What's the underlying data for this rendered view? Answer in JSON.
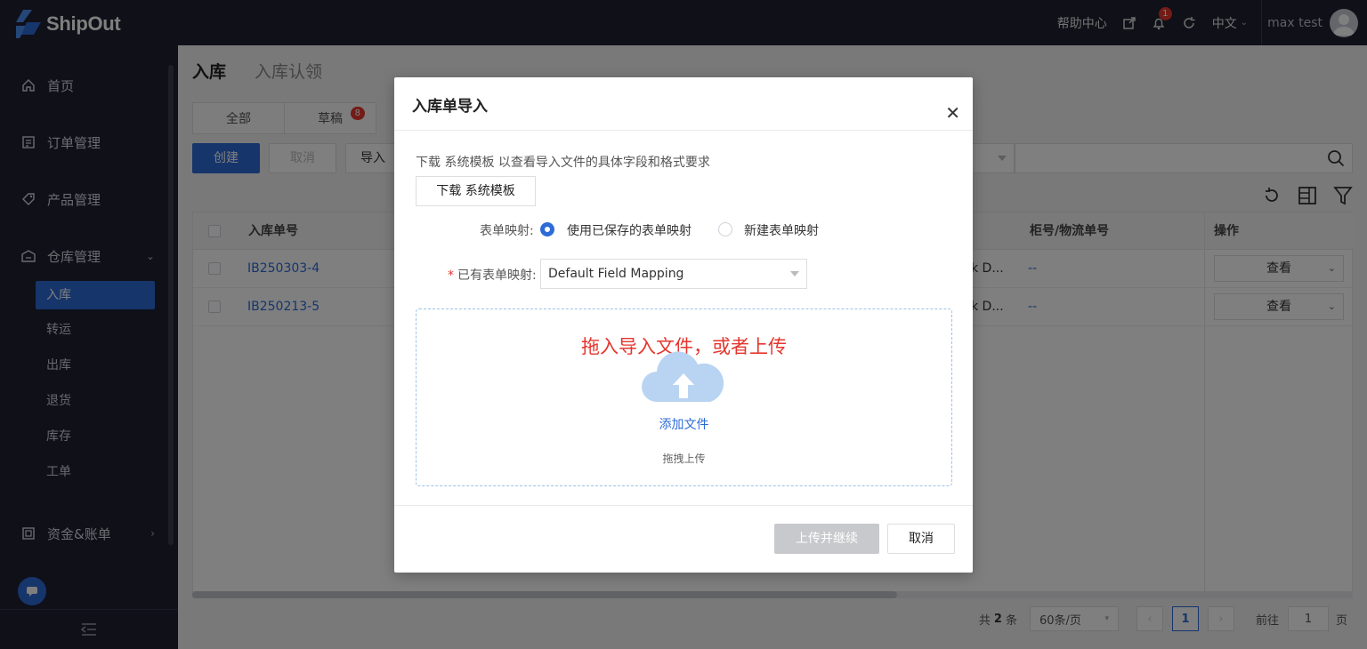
{
  "app": {
    "name": "ShipOut"
  },
  "topbar": {
    "help": "帮助中心",
    "notif_count": "1",
    "language": "中文",
    "user": "max test"
  },
  "sidebar": {
    "items": [
      {
        "label": "首页",
        "icon": "home-icon"
      },
      {
        "label": "订单管理",
        "icon": "order-icon"
      },
      {
        "label": "产品管理",
        "icon": "tag-icon"
      },
      {
        "label": "仓库管理",
        "icon": "warehouse-icon"
      },
      {
        "label": "资金&账单",
        "icon": "bill-icon"
      }
    ],
    "sub_items": [
      "入库",
      "转运",
      "出库",
      "退货",
      "库存",
      "工单"
    ]
  },
  "page": {
    "tab_active": "入库",
    "tab_other": "入库认领",
    "status_tabs": [
      {
        "label": "全部"
      },
      {
        "label": "草稿",
        "count": "8"
      }
    ],
    "toolbar": {
      "create": "创建",
      "cancel": "取消",
      "import": "导入"
    }
  },
  "table": {
    "headers": {
      "order_no": "入库单号",
      "container": "柜号/物流单号",
      "action": "操作"
    },
    "rows": [
      {
        "order_no": "IB250303-4",
        "col_partial": "k D...",
        "container": "--",
        "action": "查看"
      },
      {
        "order_no": "IB250213-5",
        "col_partial": "k D...",
        "container": "--",
        "action": "查看"
      }
    ]
  },
  "pager": {
    "total_prefix": "共",
    "total": "2",
    "total_suffix": "条",
    "page_size": "60条/页",
    "current": "1",
    "goto_label": "前往",
    "goto_value": "1",
    "page_unit": "页"
  },
  "modal": {
    "title": "入库单导入",
    "hint": "下载 系统模板 以查看导入文件的具体字段和格式要求",
    "download_btn": "下载 系统模板",
    "mapping_label": "表单映射:",
    "radio_saved": "使用已保存的表单映射",
    "radio_new": "新建表单映射",
    "existing_label": "已有表单映射:",
    "existing_value": "Default Field Mapping",
    "drop_main": "拖入导入文件，或者上传",
    "add_file": "添加文件",
    "drag_hint": "拖拽上传",
    "upload_btn": "上传并继续",
    "cancel_btn": "取消"
  },
  "colors": {
    "primary": "#2d6bd6",
    "sidebar_bg": "#1f2130",
    "danger": "#e5362e"
  }
}
